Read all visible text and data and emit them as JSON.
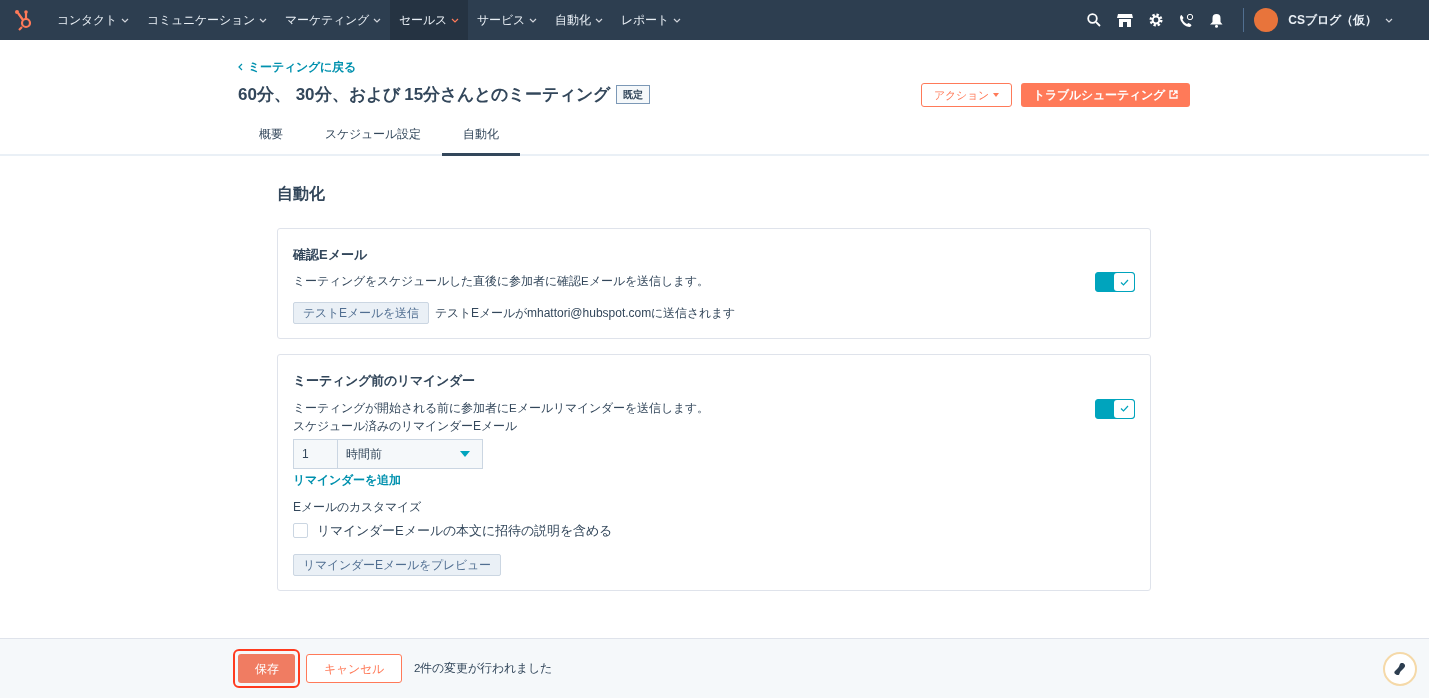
{
  "nav": {
    "items": [
      {
        "label": "コンタクト",
        "selected": false
      },
      {
        "label": "コミュニケーション",
        "selected": false
      },
      {
        "label": "マーケティング",
        "selected": false
      },
      {
        "label": "セールス",
        "selected": true
      },
      {
        "label": "サービス",
        "selected": false
      },
      {
        "label": "自動化",
        "selected": false
      },
      {
        "label": "レポート",
        "selected": false
      }
    ],
    "account": "CSブログ（仮）"
  },
  "header": {
    "back_link": "ミーティングに戻る",
    "title": "60分、 30分、および 15分さんとのミーティング",
    "badge": "既定",
    "actions_button": "アクション",
    "troubleshoot_button": "トラブルシューティング"
  },
  "tabs": [
    {
      "label": "概要",
      "selected": false
    },
    {
      "label": "スケジュール設定",
      "selected": false
    },
    {
      "label": "自動化",
      "selected": true
    }
  ],
  "section_title": "自動化",
  "confirmation": {
    "title": "確認Eメール",
    "description": "ミーティングをスケジュールした直後に参加者に確認Eメールを送信します。",
    "on": true,
    "test_button": "テストEメールを送信",
    "test_note": "テストEメールがmhattori@hubspot.comに送信されます"
  },
  "reminder": {
    "title": "ミーティング前のリマインダー",
    "description": "ミーティングが開始される前に参加者にEメールリマインダーを送信します。",
    "on": true,
    "schedule_label": "スケジュール済みのリマインダーEメール",
    "amount": "1",
    "unit": "時間前",
    "add_link": "リマインダーを追加",
    "customize_label": "Eメールのカスタマイズ",
    "include_description": {
      "label": "リマインダーEメールの本文に招待の説明を含める",
      "checked": false
    },
    "preview_button": "リマインダーEメールをプレビュー"
  },
  "footer": {
    "save_button": "保存",
    "cancel_button": "キャンセル",
    "status": "2件の変更が行われました"
  }
}
